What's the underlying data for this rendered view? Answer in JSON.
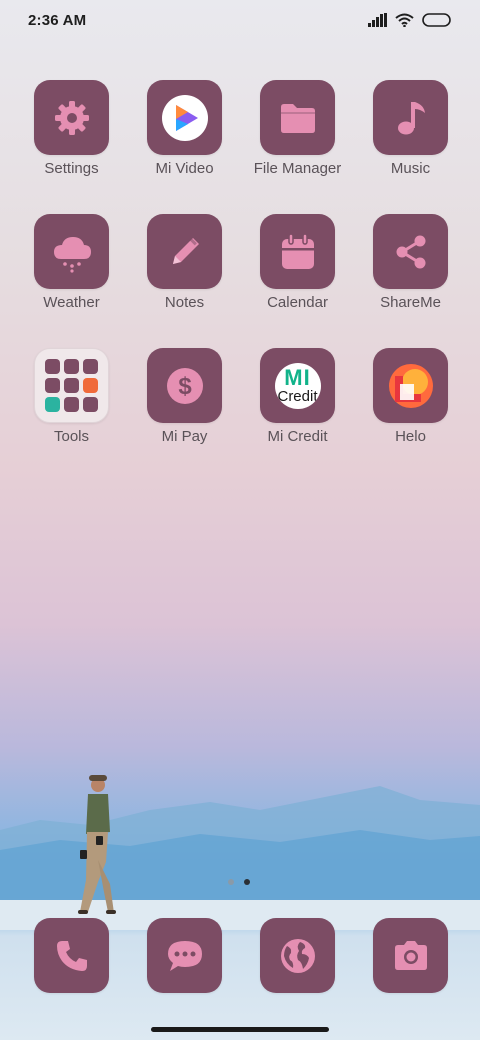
{
  "status": {
    "time": "2:36 AM"
  },
  "apps": [
    {
      "label": "Settings",
      "icon": "gear-icon"
    },
    {
      "label": "Mi Video",
      "icon": "play-icon"
    },
    {
      "label": "File Manager",
      "icon": "folder-icon"
    },
    {
      "label": "Music",
      "icon": "music-note-icon"
    },
    {
      "label": "Weather",
      "icon": "cloud-rain-icon"
    },
    {
      "label": "Notes",
      "icon": "pencil-icon"
    },
    {
      "label": "Calendar",
      "icon": "calendar-icon"
    },
    {
      "label": "ShareMe",
      "icon": "share-icon"
    },
    {
      "label": "Tools",
      "icon": "folder-grid-icon"
    },
    {
      "label": "Mi Pay",
      "icon": "dollar-icon"
    },
    {
      "label": "Mi Credit",
      "icon": "mi-credit-logo",
      "logo_text": "MI",
      "logo_sub": "Credit"
    },
    {
      "label": "Helo",
      "icon": "helo-logo"
    }
  ],
  "dock": [
    {
      "icon": "phone-icon"
    },
    {
      "icon": "message-icon"
    },
    {
      "icon": "globe-icon"
    },
    {
      "icon": "camera-icon"
    }
  ],
  "pager": {
    "pages": 2,
    "active": 2
  },
  "colors": {
    "tile": "#7c4c64",
    "glyph": "#e58fb2",
    "label": "#5a5258"
  }
}
